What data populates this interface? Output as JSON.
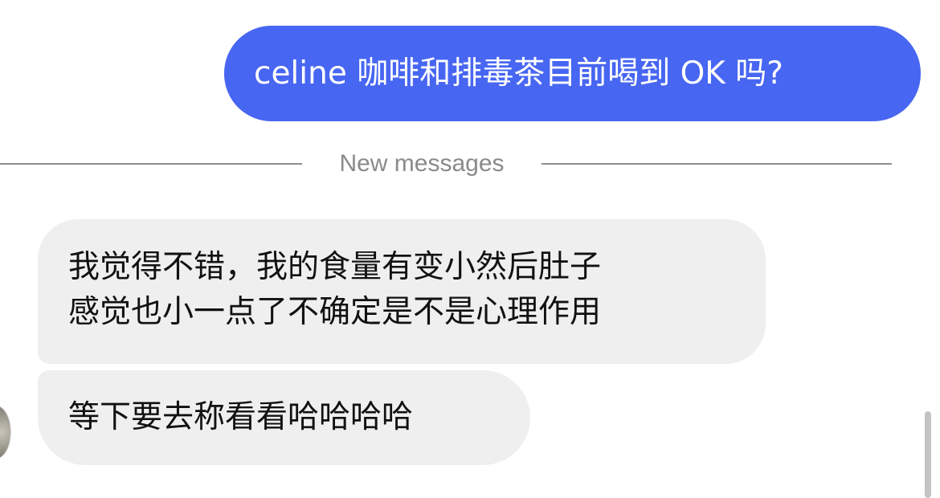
{
  "messages": [
    {
      "direction": "outgoing",
      "text": "celine 咖啡和排毒茶目前喝到 OK 吗?"
    },
    {
      "direction": "incoming",
      "lines": [
        "我觉得不错，我的食量有变小然后肚子",
        "感觉也小一点了不确定是不是心理作用"
      ]
    },
    {
      "direction": "incoming",
      "text": "等下要去称看看哈哈哈哈"
    }
  ],
  "divider": {
    "label": "New messages"
  },
  "colors": {
    "outgoing_bubble": "#4766f2",
    "incoming_bubble": "#efefef",
    "divider_text": "#8a8a8a"
  },
  "icons": {
    "avatar": "contact-avatar"
  }
}
